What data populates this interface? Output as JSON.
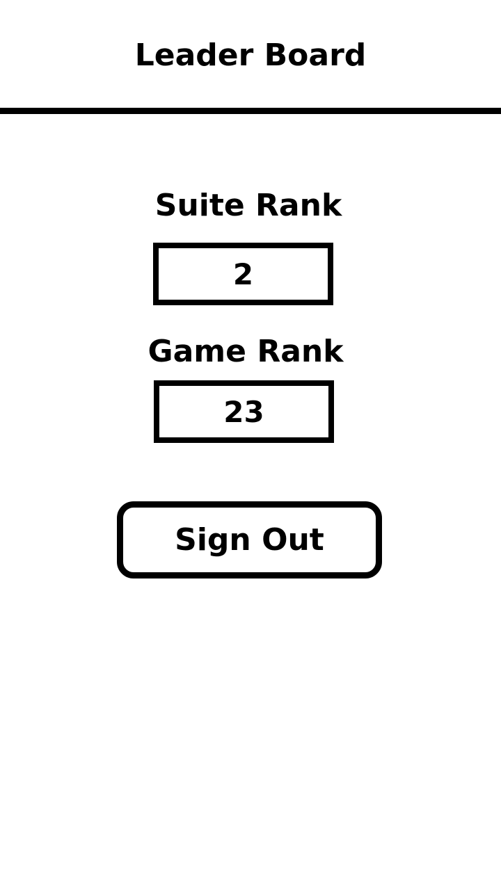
{
  "header": {
    "title": "Leader Board"
  },
  "suite_rank": {
    "label": "Suite Rank",
    "value": "2"
  },
  "game_rank": {
    "label": "Game Rank",
    "value": "23"
  },
  "actions": {
    "sign_out_label": "Sign Out"
  },
  "colors": {
    "background": "#ffffff",
    "foreground": "#000000"
  }
}
